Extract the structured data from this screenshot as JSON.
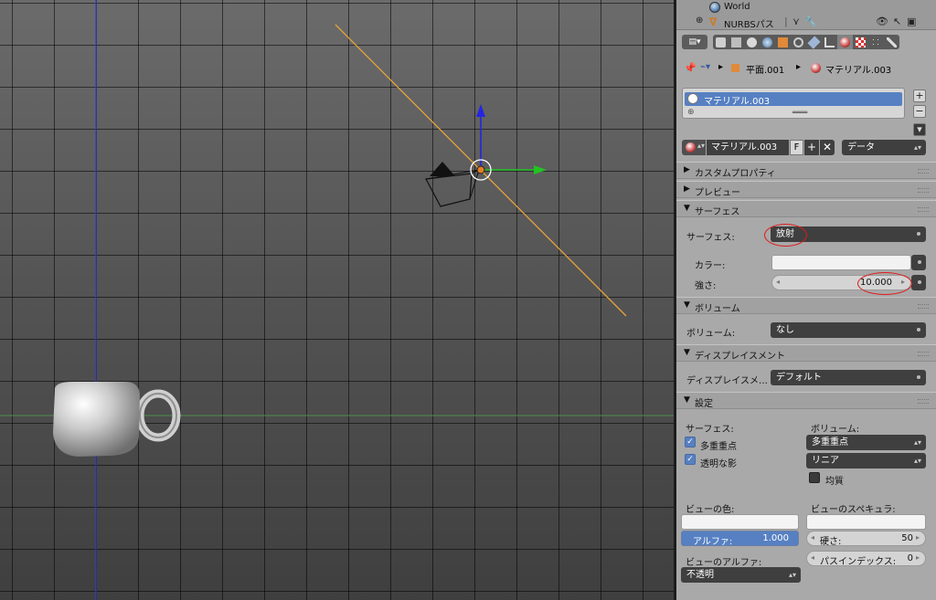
{
  "outliner": {
    "rows": [
      {
        "label": "World",
        "icon": "world-icon"
      },
      {
        "label": "NURBSパス",
        "icon": "nurbs-path-icon"
      }
    ]
  },
  "breadcrumb": {
    "object": "平面.001",
    "material": "マテリアル.003"
  },
  "material_slots": {
    "items": [
      "マテリアル.003"
    ]
  },
  "datablock": {
    "name": "マテリアル.003",
    "fake_user": "F",
    "link_mode": "データ"
  },
  "sections": {
    "custom_properties": "カスタムプロパティ",
    "preview": "プレビュー",
    "surface": "サーフェス",
    "volume": "ボリューム",
    "displacement": "ディスプレイスメント",
    "settings": "設定"
  },
  "surface": {
    "surface_label": "サーフェス:",
    "surface_value": "放射",
    "color_label": "カラー:",
    "color_value": "#f2f2f2",
    "strength_label": "強さ:",
    "strength_value": "10.000"
  },
  "volume": {
    "label": "ボリューム:",
    "value": "なし"
  },
  "displacement": {
    "label": "ディスプレイスメ…",
    "value": "デフォルト"
  },
  "settings": {
    "surface_header": "サーフェス:",
    "multiple_importance": "多重重点",
    "transparent_shadows": "透明な影",
    "volume_header": "ボリューム:",
    "volume_sampling": "多重重点",
    "volume_interpolation": "リニア",
    "homogeneous": "均質",
    "viewport_color_label": "ビューの色:",
    "alpha_label": "アルファ:",
    "alpha_value": "1.000",
    "viewport_specular_label": "ビューのスペキュラ:",
    "hardness_label": "硬さ:",
    "hardness_value": "50",
    "viewport_alpha_label": "ビューのアルファ:",
    "viewport_alpha_value": "不透明",
    "pass_index_label": "パスインデックス:",
    "pass_index_value": "0"
  },
  "colors": {
    "selection_blue": "#5680c2",
    "field_dark": "#3f3f3f",
    "panel_bg": "#a9a9a9",
    "annotation_red": "#e01a1a",
    "lamp_line": "#e6a23c"
  }
}
